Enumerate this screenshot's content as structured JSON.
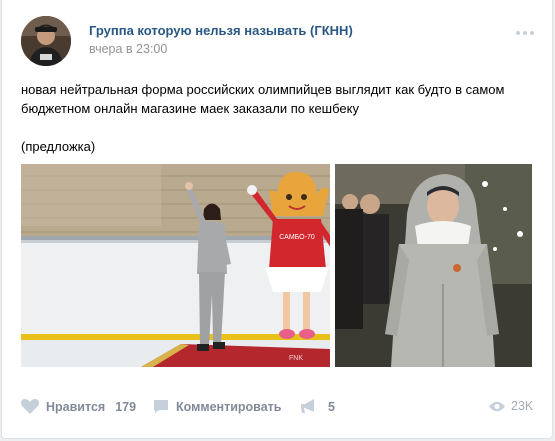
{
  "post": {
    "author": "Группа которую нельзя называть (ГКНН)",
    "time": "вчера в 23:00",
    "text": "новая нейтральная форма российских олимпийцев выглядит как будто в самом бюджетном онлайн магазине маек заказали по кешбеку\n\n(предложка)",
    "photo1_banner": "САМБО-70",
    "photo1_watermark": "FNK"
  },
  "actions": {
    "like_label": "Нравится",
    "like_count": "179",
    "comment_label": "Комментировать",
    "share_count": "5",
    "views_count": "23K"
  },
  "colors": {
    "link": "#2a5885",
    "muted": "#828a99",
    "background": "#edeef0"
  },
  "icons": {
    "like": "heart-icon",
    "comment": "comment-icon",
    "share": "megaphone-icon",
    "views": "eye-icon",
    "menu": "more-dots-icon"
  }
}
